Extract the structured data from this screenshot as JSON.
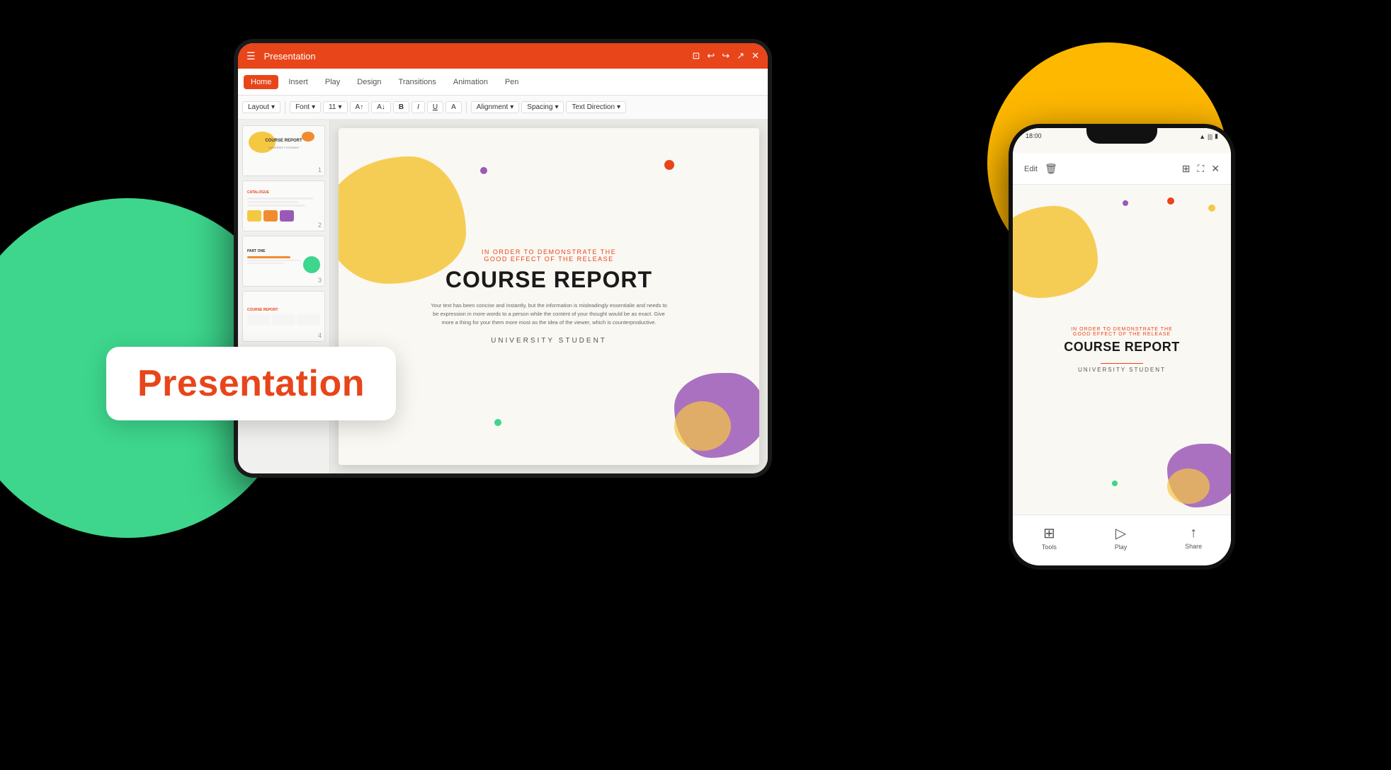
{
  "background": {
    "color": "#000000"
  },
  "circles": {
    "green": {
      "color": "#3DD68C"
    },
    "yellow": {
      "color": "#FFB800"
    }
  },
  "presentation_card": {
    "label": "Presentation"
  },
  "tablet": {
    "titlebar": {
      "title": "Presentation",
      "icons": [
        "minimize",
        "undo",
        "redo",
        "share",
        "close"
      ]
    },
    "toolbar_tabs": [
      "Home",
      "Insert",
      "Play",
      "Design",
      "Transitions",
      "Animation",
      "Pen"
    ],
    "active_tab": "Home",
    "format_bar": {
      "layout_label": "Layout",
      "font_label": "Font",
      "font_size": "11",
      "alignment_label": "Alignment",
      "spacing_label": "Spacing",
      "text_direction_label": "Text Direction"
    },
    "slide_panel": {
      "slides": [
        {
          "number": "1",
          "title": "COURSE REPORT"
        },
        {
          "number": "2",
          "title": "CATALOGUE"
        },
        {
          "number": "3",
          "title": "PART ONE"
        },
        {
          "number": "4",
          "title": "COURSE REPORT"
        }
      ]
    },
    "main_slide": {
      "top_subtitle": "IN ORDER TO DEMONSTRATE THE\nGOOD EFFECT OF THE RELEASE",
      "title": "COURSE REPORT",
      "body_text": "Your text has been concise and instantly, but the information is misleadingly essentialie and needs to be expression in more words to a person while the content of your thought would be as exact. Give more a thing for your them more most as the idea of the viewer, which is counterproductive.",
      "bottom_label": "UNIVERSITY STUDENT"
    }
  },
  "phone": {
    "status_bar": {
      "time": "18:00",
      "wifi": "▼",
      "signal": "|||",
      "battery": "■"
    },
    "toolbar": {
      "edit_label": "Edit",
      "icons": [
        "trash",
        "grid",
        "expand",
        "close"
      ]
    },
    "slide": {
      "subtitle": "IN ORDER TO DEMONSTRATE THE\nGOOD EFFECT OF THE RELEASE",
      "title": "COURSE REPORT",
      "student": "UNIVERSITY STUDENT"
    },
    "bottom_bar": [
      {
        "icon": "⊞",
        "label": "Tools"
      },
      {
        "icon": "▷",
        "label": "Play"
      },
      {
        "icon": "↑",
        "label": "Share"
      }
    ]
  }
}
